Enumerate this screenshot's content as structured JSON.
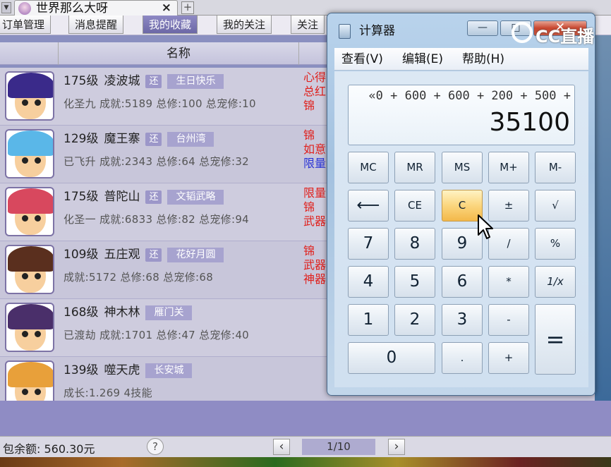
{
  "tab": {
    "title": "世界那么大呀",
    "close": "×",
    "new": "+"
  },
  "nav": {
    "items": [
      "订单管理",
      "消息提醒",
      "我的收藏",
      "我的关注",
      "关注"
    ]
  },
  "list": {
    "column_header": "名称",
    "rows": [
      {
        "level": "175级",
        "name": "凌波城",
        "badge": "还",
        "server": "生日快乐",
        "stats": "化圣九 成就:5189 总修:100 总宠修:10",
        "side": [
          "心得",
          "总红",
          "锦"
        ]
      },
      {
        "level": "129级",
        "name": "魔王寨",
        "badge": "还",
        "server": "台州湾",
        "stats": "已飞升 成就:2343 总修:64 总宠修:32",
        "side": [
          "锦",
          "如意",
          "限量"
        ]
      },
      {
        "level": "175级",
        "name": "普陀山",
        "badge": "还",
        "server": "文韬武略",
        "stats": "化圣一 成就:6833 总修:82 总宠修:94",
        "side": [
          "限量",
          "锦",
          "武器"
        ]
      },
      {
        "level": "109级",
        "name": "五庄观",
        "badge": "还",
        "server": "花好月圆",
        "stats": "成就:5172 总修:68 总宠修:68",
        "side": [
          "锦",
          "武器",
          "神器"
        ]
      },
      {
        "level": "168级",
        "name": "神木林",
        "badge": "",
        "server": "雁门关",
        "stats": "已渡劫 成就:1701 总修:47 总宠修:40",
        "side": []
      },
      {
        "level": "139级",
        "name": "噬天虎",
        "badge": "",
        "server": "长安城",
        "stats": "成长:1.269 4技能",
        "side": []
      }
    ]
  },
  "footer": {
    "balance": "包余额: 560.30元",
    "help": "?",
    "prev": "‹",
    "page": "1/10",
    "next": "›"
  },
  "watermark": {
    "text": "CC直播"
  },
  "calculator": {
    "title": "计算器",
    "controls": {
      "minimize": "—",
      "maximize": "□",
      "close": "✕"
    },
    "menu": [
      "查看(V)",
      "编辑(E)",
      "帮助(H)"
    ],
    "display": {
      "expression": "«0 + 600 + 600 + 200 + 500 +",
      "value": "35100"
    },
    "keys": {
      "mc": "MC",
      "mr": "MR",
      "ms": "MS",
      "mplus": "M+",
      "mminus": "M-",
      "back": "⟵",
      "ce": "CE",
      "c": "C",
      "pm": "±",
      "sqrt": "√",
      "k7": "7",
      "k8": "8",
      "k9": "9",
      "div": "/",
      "pct": "%",
      "k4": "4",
      "k5": "5",
      "k6": "6",
      "mul": "*",
      "inv": "1/x",
      "k1": "1",
      "k2": "2",
      "k3": "3",
      "sub": "-",
      "eq": "=",
      "k0": "0",
      "dot": ".",
      "add": "+"
    }
  },
  "colors": {
    "accent_nav": "#7a76b5",
    "list_bg": "#ceccde",
    "side_red": "#e0201c",
    "side_blue": "#2a34d6"
  }
}
